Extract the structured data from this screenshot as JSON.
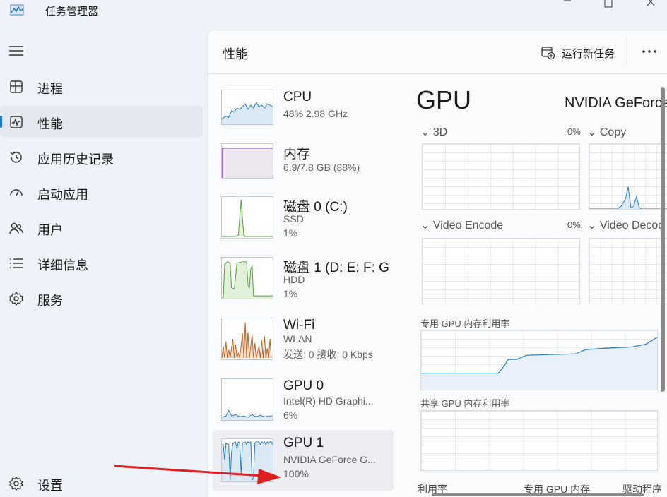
{
  "app": {
    "title": "任务管理器"
  },
  "sidebar": {
    "items": [
      {
        "label": "进程",
        "icon": "processes-icon"
      },
      {
        "label": "性能",
        "icon": "performance-icon",
        "active": true
      },
      {
        "label": "应用历史记录",
        "icon": "app-history-icon"
      },
      {
        "label": "启动应用",
        "icon": "startup-apps-icon"
      },
      {
        "label": "用户",
        "icon": "users-icon"
      },
      {
        "label": "详细信息",
        "icon": "details-icon"
      },
      {
        "label": "服务",
        "icon": "services-icon"
      }
    ],
    "settings_label": "设置"
  },
  "header": {
    "title": "性能",
    "run_task": "运行新任务"
  },
  "devices": [
    {
      "name": "CPU",
      "lines": [
        "48% 2.98 GHz"
      ],
      "color": "#1f7bc1"
    },
    {
      "name": "内存",
      "lines": [
        "6.9/7.8 GB (88%)"
      ],
      "color": "#8b2bb5"
    },
    {
      "name": "磁盘 0 (C:)",
      "lines": [
        "SSD",
        "1%"
      ],
      "color": "#4da32f"
    },
    {
      "name": "磁盘 1 (D: E: F: G",
      "lines": [
        "HDD",
        "1%"
      ],
      "color": "#4da32f"
    },
    {
      "name": "Wi-Fi",
      "lines": [
        "WLAN",
        "发送: 0 接收: 0 Kbps"
      ],
      "color": "#c2601c"
    },
    {
      "name": "GPU 0",
      "lines": [
        "Intel(R) HD Graphi...",
        "6%"
      ],
      "color": "#1f7bc1"
    },
    {
      "name": "GPU 1",
      "lines": [
        "NVIDIA GeForce G...",
        "100%"
      ],
      "color": "#1f7bc1",
      "active": true
    }
  ],
  "detail": {
    "title": "GPU",
    "model": "NVIDIA GeForce",
    "engines": [
      {
        "label": "3D",
        "pct": "0%"
      },
      {
        "label": "Copy",
        "pct": ""
      },
      {
        "label": "Video Encode",
        "pct": "0%"
      },
      {
        "label": "Video Decode",
        "pct": ""
      }
    ],
    "dedicated_label": "专用 GPU 内存利用率",
    "shared_label": "共享 GPU 内存利用率",
    "bottom": [
      "利用率",
      "专用 GPU 内存",
      "驱动程序"
    ]
  }
}
